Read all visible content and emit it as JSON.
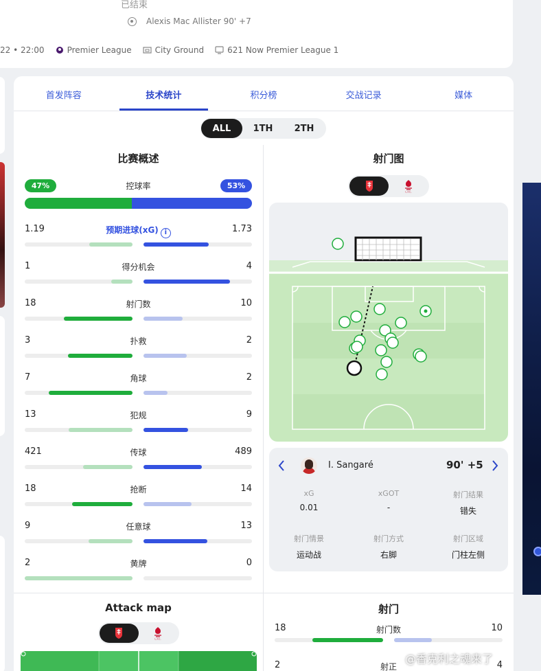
{
  "match": {
    "status": "已结束",
    "scorer": "Alexis Mac Allister 90' +7",
    "datetime": "22 • 22:00",
    "league": "Premier League",
    "venue": "City Ground",
    "broadcast": "621 Now Premier League 1"
  },
  "tabs": [
    "首发阵容",
    "技术统计",
    "积分榜",
    "交战记录",
    "媒体"
  ],
  "active_tab": 1,
  "periods": [
    "ALL",
    "1TH",
    "2TH"
  ],
  "active_period": 0,
  "overview": {
    "title": "比赛概述",
    "possession": {
      "label": "控球率",
      "home": "47%",
      "away": "53%",
      "home_value": 47,
      "away_value": 53
    },
    "stats": [
      {
        "label": "预期进球(xG)",
        "home": "1.19",
        "away": "1.73",
        "home_fill": 0.4,
        "away_fill": 0.6,
        "home_strong": false,
        "away_strong": true,
        "link": true
      },
      {
        "label": "得分机会",
        "home": "1",
        "away": "4",
        "home_fill": 0.2,
        "away_fill": 0.8,
        "home_strong": false,
        "away_strong": true
      },
      {
        "label": "射门数",
        "home": "18",
        "away": "10",
        "home_fill": 0.64,
        "away_fill": 0.36,
        "home_strong": true,
        "away_strong": false
      },
      {
        "label": "扑救",
        "home": "3",
        "away": "2",
        "home_fill": 0.6,
        "away_fill": 0.4,
        "home_strong": true,
        "away_strong": false
      },
      {
        "label": "角球",
        "home": "7",
        "away": "2",
        "home_fill": 0.78,
        "away_fill": 0.22,
        "home_strong": true,
        "away_strong": false
      },
      {
        "label": "犯规",
        "home": "13",
        "away": "9",
        "home_fill": 0.59,
        "away_fill": 0.41,
        "home_strong": false,
        "away_strong": true
      },
      {
        "label": "传球",
        "home": "421",
        "away": "489",
        "home_fill": 0.46,
        "away_fill": 0.54,
        "home_strong": false,
        "away_strong": true
      },
      {
        "label": "抢断",
        "home": "18",
        "away": "14",
        "home_fill": 0.56,
        "away_fill": 0.44,
        "home_strong": true,
        "away_strong": false
      },
      {
        "label": "任意球",
        "home": "9",
        "away": "13",
        "home_fill": 0.41,
        "away_fill": 0.59,
        "home_strong": false,
        "away_strong": true
      },
      {
        "label": "黄牌",
        "home": "2",
        "away": "0",
        "home_fill": 1.0,
        "away_fill": 0.0,
        "home_strong": false,
        "away_strong": false
      }
    ]
  },
  "shot_map": {
    "title": "射门图",
    "selected_shot": {
      "player": "I. Sangaré",
      "minute": "90' +5",
      "xg_label": "xG",
      "xg": "0.01",
      "xgot_label": "xGOT",
      "xgot": "-",
      "result_label": "射门结果",
      "result": "错失",
      "situation_label": "射门情景",
      "situation": "运动战",
      "body_label": "射门方式",
      "body": "右脚",
      "zone_label": "射门区域",
      "zone": "门柱左侧"
    }
  },
  "attack_map": {
    "title": "Attack map"
  },
  "shots_panel": {
    "title": "射门",
    "rows": [
      {
        "label": "射门数",
        "home": "18",
        "away": "10"
      },
      {
        "label": "射正",
        "home": "2",
        "away": "4"
      }
    ]
  },
  "watermark": "@香克利之魂来了",
  "colors": {
    "home": "#1fad3c",
    "away": "#3452e0",
    "tab_accent": "#2b45c9"
  }
}
